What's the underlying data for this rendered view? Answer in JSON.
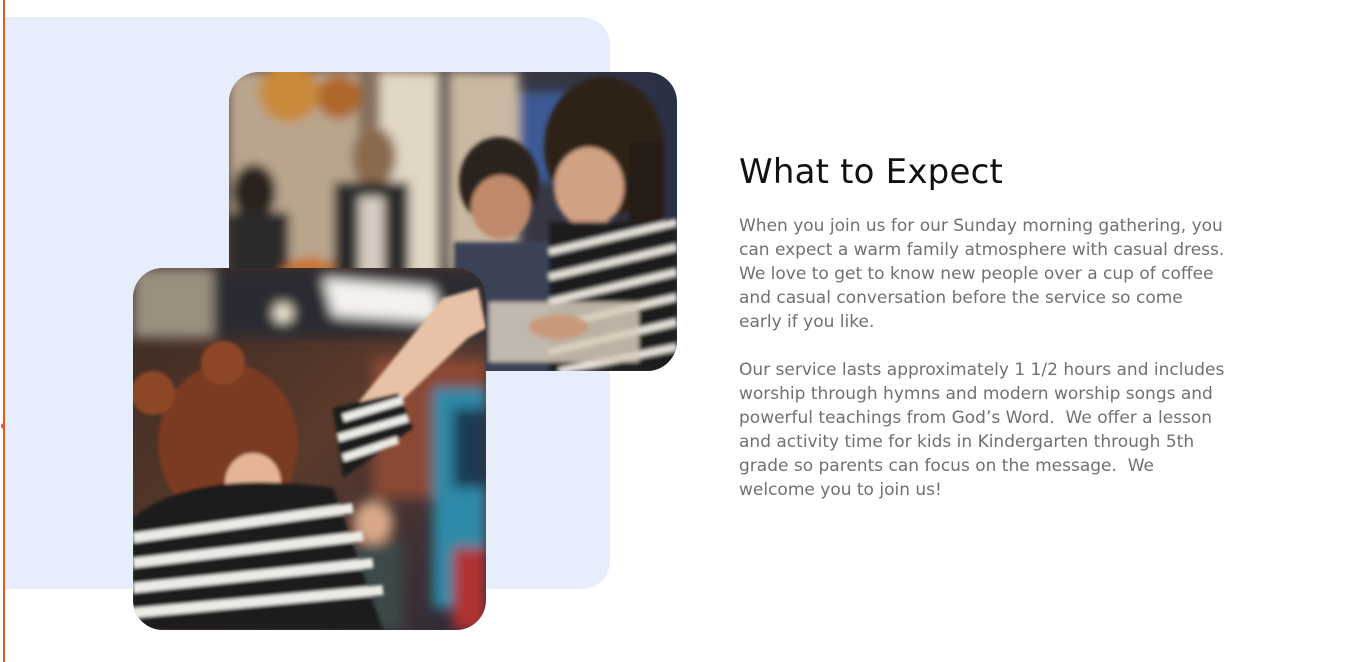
{
  "section": {
    "title": "What to Expect",
    "paragraphs": [
      "When you join us for our Sunday morning gathering, you can expect a warm family atmosphere with casual dress.  We love to get to know new people over a cup of coffee and casual conversation before the service so come early if you like.",
      "Our service lasts approximately 1 1/2 hours and includes worship through hymns and modern worship songs and powerful teachings from God’s Word.  We offer a lesson and activity time for kids in Kindergarten through 5th grade so parents can focus on the message.  We welcome you to join us!"
    ]
  },
  "colors": {
    "accent": "#e8582a",
    "panel_background": "#e6eefc",
    "heading": "#111111",
    "body_text": "#707070"
  }
}
